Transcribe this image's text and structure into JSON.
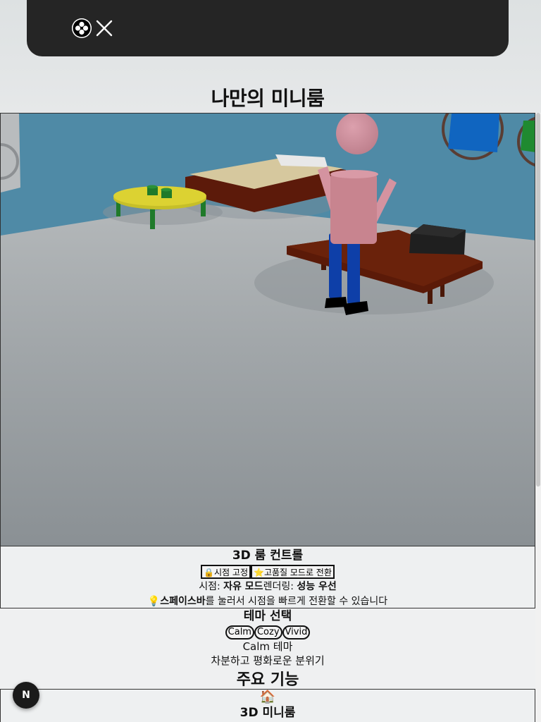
{
  "page": {
    "title": "나만의 미니룸"
  },
  "topbar": {
    "logo_icon": "clover-icon",
    "close_icon": "close-icon"
  },
  "controls": {
    "heading": "3D 룸 컨트롤",
    "lock_button": "🔒시점 고정",
    "quality_button": "⭐고품질 모드로 전환",
    "view_label": "시점: ",
    "view_value": "자유 모드",
    "render_label": "렌더링: ",
    "render_value": "성능 우선",
    "tip_icon": "💡",
    "tip_key": "스페이스바",
    "tip_text": "를 눌러서 시점을 빠르게 전환할 수 있습니다"
  },
  "theme": {
    "heading": "테마 선택",
    "options": [
      "Calm",
      "Cozy",
      "Vivid"
    ],
    "current": "Calm 테마",
    "description": "차분하고 평화로운 분위기"
  },
  "features": {
    "heading": "주요 기능",
    "items": [
      {
        "icon": "🏠",
        "name": "3D 미니룸"
      }
    ]
  },
  "badge": {
    "letter": "N"
  },
  "colors": {
    "topbar": "#252525",
    "wall": "#4f8aa6",
    "floor": "#9aa0a3"
  }
}
